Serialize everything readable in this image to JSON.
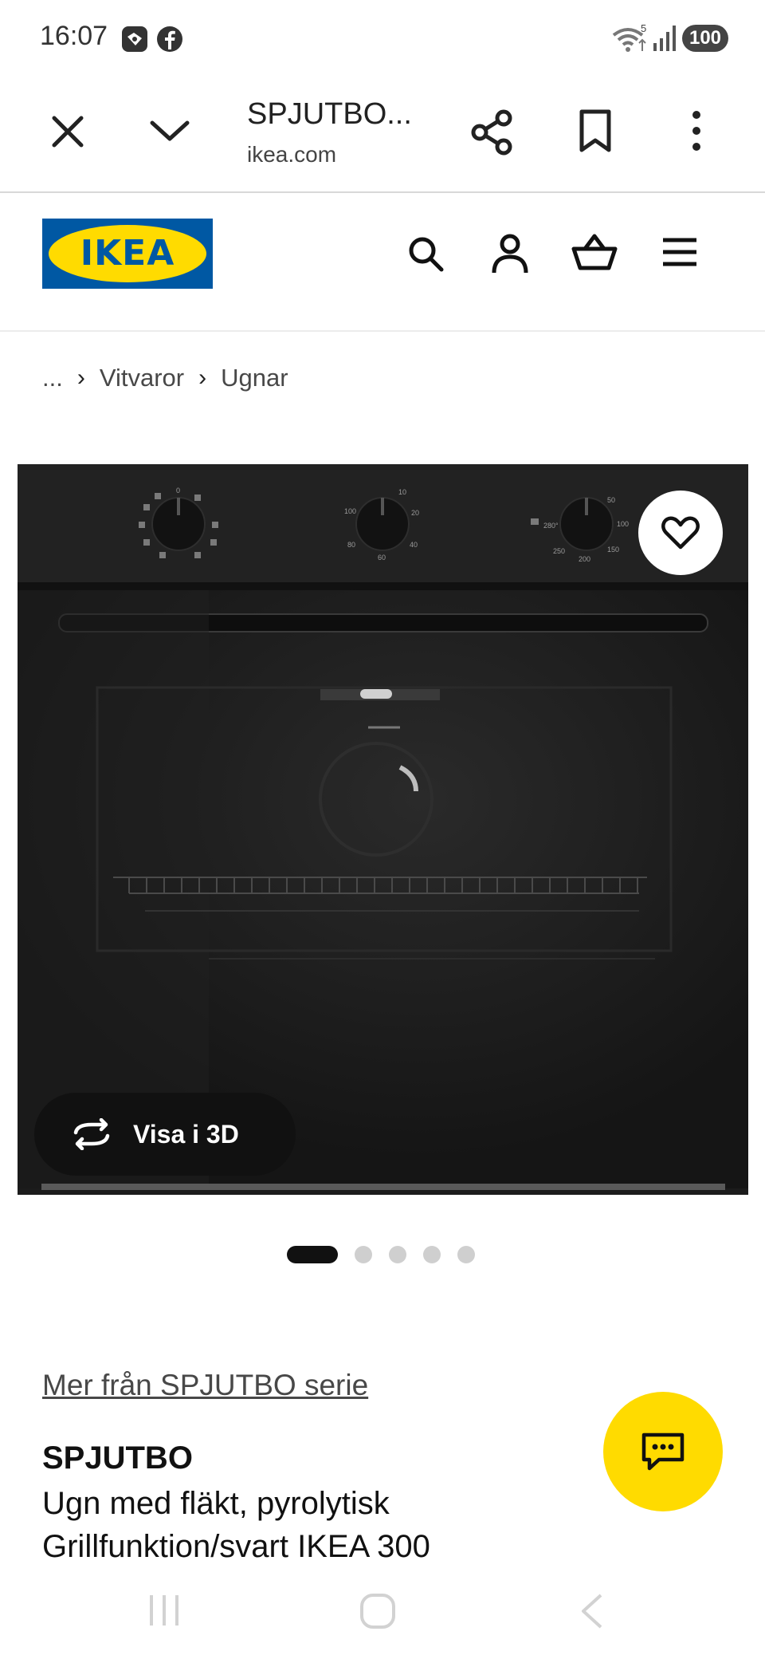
{
  "status_bar": {
    "time": "16:07",
    "battery": "100",
    "wifi_sub": "5",
    "icons": [
      "messaging-app-icon",
      "facebook-icon",
      "wifi-icon",
      "cell-signal-icon",
      "battery-icon"
    ]
  },
  "browser": {
    "title": "SPJUTBO...",
    "domain": "ikea.com",
    "icons": [
      "close-icon",
      "chevron-down-icon",
      "share-icon",
      "bookmark-icon",
      "more-vert-icon"
    ]
  },
  "site_header": {
    "logo_text": "IKEA",
    "icons": [
      "search-icon",
      "account-icon",
      "basket-icon",
      "menu-icon"
    ]
  },
  "breadcrumb": {
    "items": [
      "...",
      "Vitvaror",
      "Ugnar"
    ]
  },
  "gallery": {
    "view_3d_label": "Visa i 3D",
    "dial_1_label": "0",
    "dial_2_labels": [
      "10",
      "20",
      "40",
      "60",
      "80",
      "100"
    ],
    "dial_3_labels": [
      "50",
      "100",
      "150",
      "200",
      "250",
      "280°"
    ],
    "image_count": 5,
    "active_index": 0
  },
  "product": {
    "series_link": "Mer från SPJUTBO serie",
    "name": "SPJUTBO",
    "description": "Ugn med fläkt, pyrolytisk Grillfunktion/svart IKEA 300"
  },
  "colors": {
    "ikea_blue": "#0058a3",
    "ikea_yellow": "#ffdb00",
    "text_dark": "#111111",
    "text_muted": "#484848"
  }
}
